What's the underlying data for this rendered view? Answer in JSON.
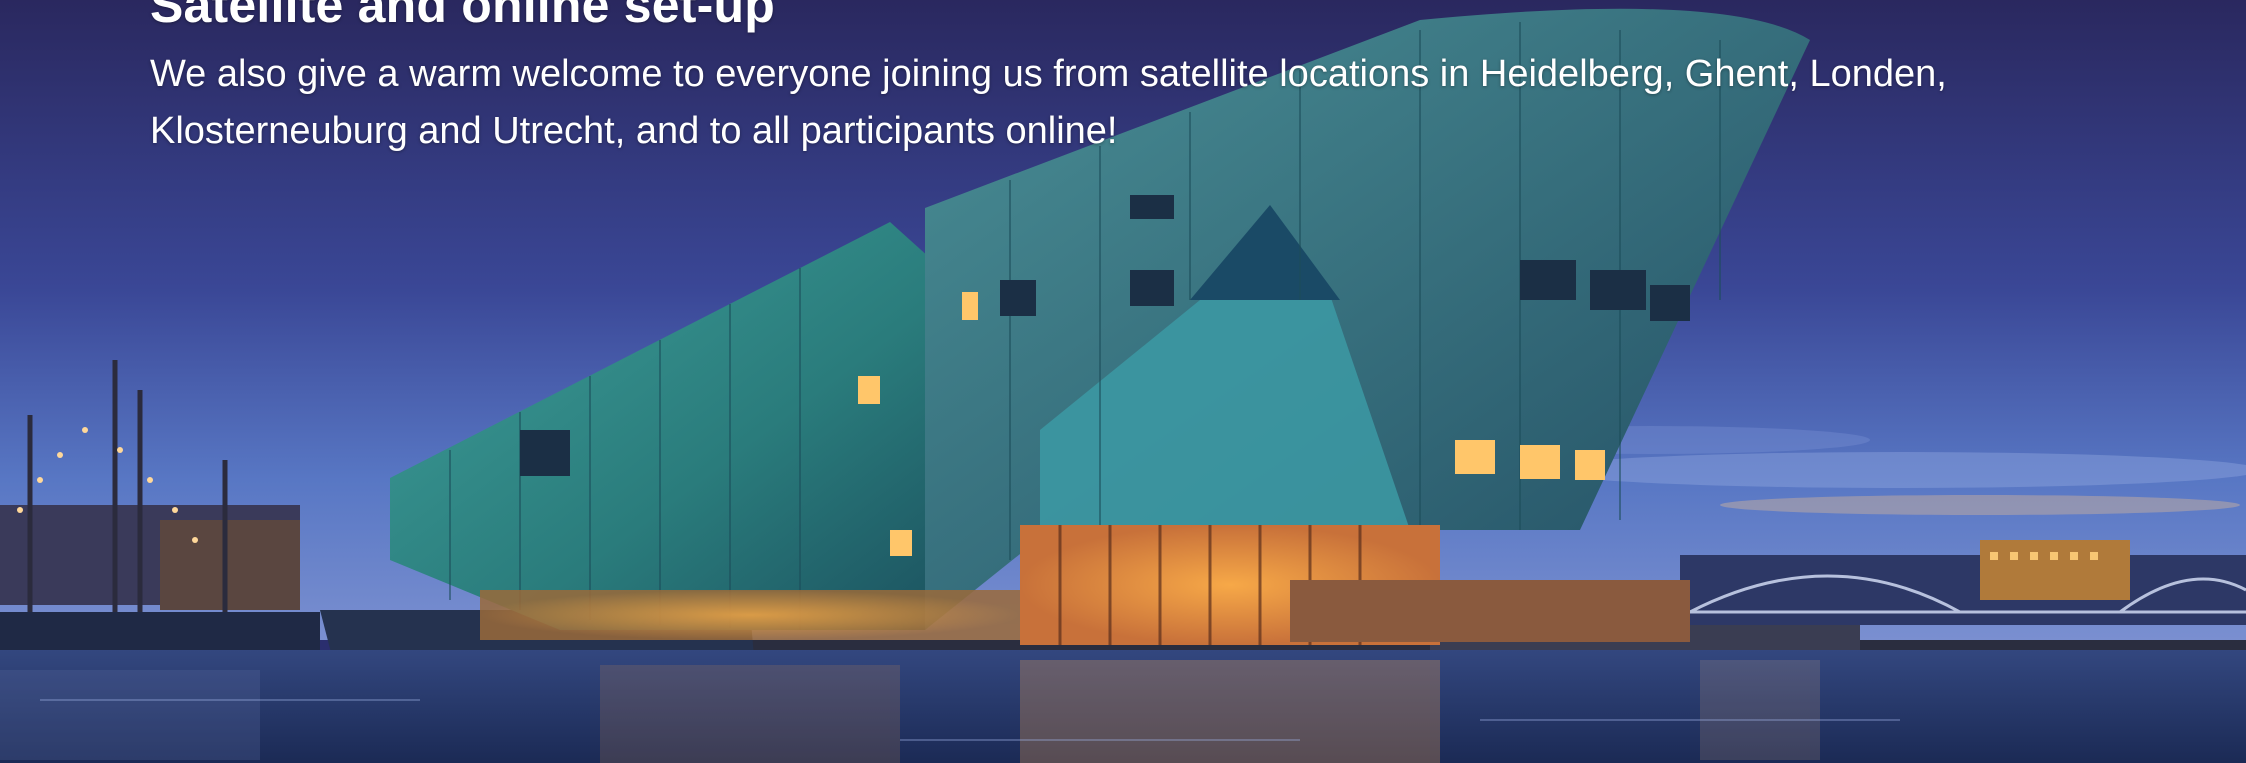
{
  "section": {
    "heading": "Satellite and online set-up",
    "body": "We also give a warm welcome to everyone joining us from satellite locations in Heidelberg, Ghent, Londen, Klosterneuburg and Utrecht, and to all participants online!"
  },
  "hero_image": {
    "subject": "NEMO science museum building at dusk by the waterfront",
    "colors": {
      "sky_top": "#2b2a66",
      "sky_mid": "#3c4d9b",
      "sky_horizon": "#5d79c8",
      "building": "#2f8f8a",
      "building_dark": "#1f5c63",
      "water": "#20315f",
      "light": "#ffb24a"
    }
  }
}
